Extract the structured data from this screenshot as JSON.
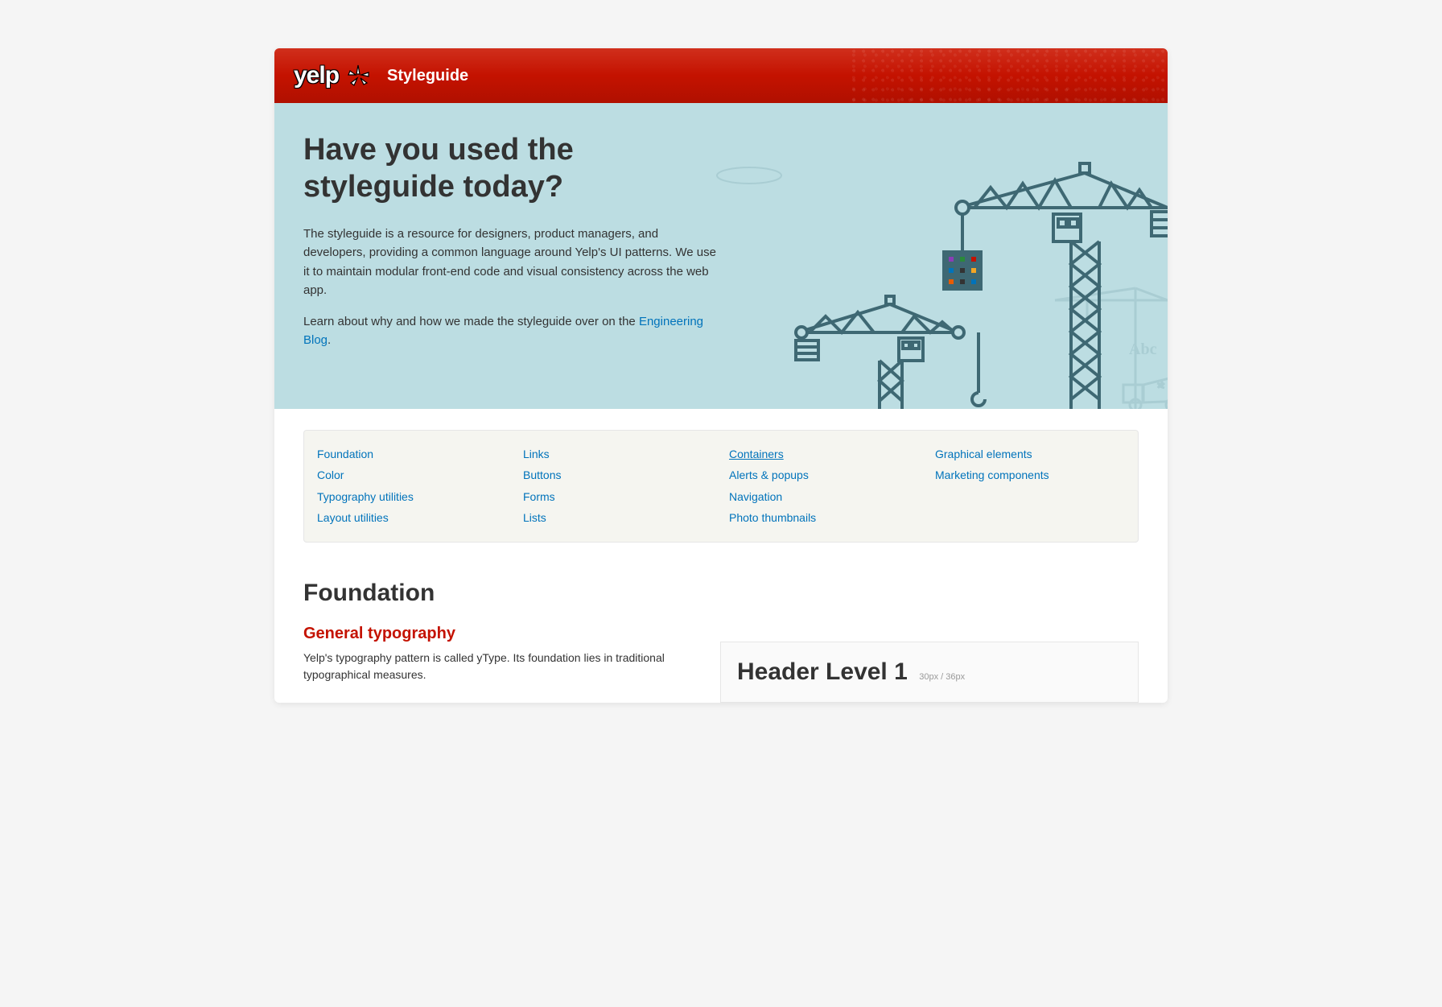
{
  "header": {
    "logo_text": "yelp",
    "title": "Styleguide"
  },
  "hero": {
    "heading": "Have you used the styleguide today?",
    "paragraph1": "The styleguide is a resource for designers, product managers, and developers, providing a common language around Yelp's UI patterns. We use it to maintain modular front-end code and visual consistency across the web app.",
    "paragraph2_prefix": "Learn about why and how we made the styleguide over on the ",
    "paragraph2_link": "Engineering Blog",
    "paragraph2_suffix": ".",
    "decoration_abc": "Abc"
  },
  "nav": {
    "col1": [
      "Foundation",
      "Color",
      "Typography utilities",
      "Layout utilities"
    ],
    "col2": [
      "Links",
      "Buttons",
      "Forms",
      "Lists"
    ],
    "col3": [
      "Containers",
      "Alerts & popups",
      "Navigation",
      "Photo thumbnails"
    ],
    "col4": [
      "Graphical elements",
      "Marketing components"
    ]
  },
  "section": {
    "heading": "Foundation",
    "subheading": "General typography",
    "body": "Yelp's typography pattern is called yType. Its foundation lies in traditional typographical measures.",
    "example_h1": "Header Level 1",
    "example_meta": "30px / 36px"
  },
  "colors": {
    "brand_red": "#c41200",
    "hero_bg": "#bcdde2",
    "link_blue": "#0073bb",
    "crane_dark": "#3e6873",
    "crane_light": "#a9cdd3"
  }
}
